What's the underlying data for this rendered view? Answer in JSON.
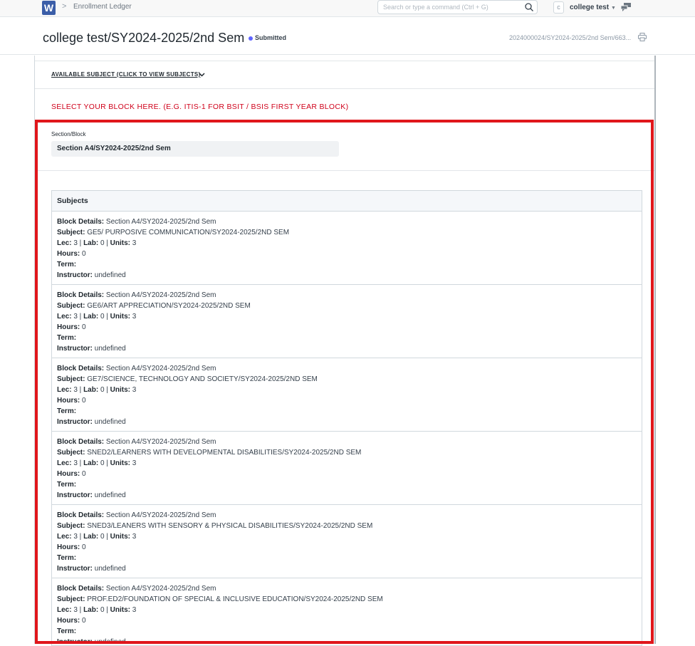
{
  "navbar": {
    "logo_letter": "W",
    "breadcrumb_sep": ">",
    "breadcrumb": "Enrollment Ledger",
    "search_placeholder": "Search or type a command (Ctrl + G)",
    "avatar_letter": "c",
    "user_name": "college test"
  },
  "header": {
    "title": "college test/SY2024-2025/2nd Sem",
    "status": "Submitted",
    "doc_id": "2024000024/SY2024-2025/2nd Sem/663..."
  },
  "form": {
    "available_subject_link": "AVAILABLE SUBJECT (CLICK TO VIEW SUBJECTS)",
    "block_instruction": "SELECT YOUR BLOCK HERE. (E.G. ITIS-1 FOR BSIT / BSIS FIRST YEAR BLOCK)",
    "section_label": "Section/Block",
    "section_value": "Section A4/SY2024-2025/2nd Sem"
  },
  "subjects": {
    "heading": "Subjects",
    "labels": {
      "block": "Block Details:",
      "subject": "Subject:",
      "lec": "Lec:",
      "lab": "Lab:",
      "units": "Units:",
      "hours": "Hours:",
      "term": "Term:",
      "instructor": "Instructor:"
    },
    "items": [
      {
        "block": "Section A4/SY2024-2025/2nd Sem",
        "subject": "GE5/ PURPOSIVE COMMUNICATION/SY2024-2025/2ND SEM",
        "lec": "3",
        "lab": "0",
        "units": "3",
        "hours": "0",
        "term": "",
        "instructor": "undefined"
      },
      {
        "block": "Section A4/SY2024-2025/2nd Sem",
        "subject": "GE6/ART APPRECIATION/SY2024-2025/2ND SEM",
        "lec": "3",
        "lab": "0",
        "units": "3",
        "hours": "0",
        "term": "",
        "instructor": "undefined"
      },
      {
        "block": "Section A4/SY2024-2025/2nd Sem",
        "subject": "GE7/SCIENCE, TECHNOLOGY AND SOCIETY/SY2024-2025/2ND SEM",
        "lec": "3",
        "lab": "0",
        "units": "3",
        "hours": "0",
        "term": "",
        "instructor": "undefined"
      },
      {
        "block": "Section A4/SY2024-2025/2nd Sem",
        "subject": "SNED2/LEARNERS WITH DEVELOPMENTAL DISABILITIES/SY2024-2025/2ND SEM",
        "lec": "3",
        "lab": "0",
        "units": "3",
        "hours": "0",
        "term": "",
        "instructor": "undefined"
      },
      {
        "block": "Section A4/SY2024-2025/2nd Sem",
        "subject": "SNED3/LEANERS WITH SENSORY & PHYSICAL DISABILITIES/SY2024-2025/2ND SEM",
        "lec": "3",
        "lab": "0",
        "units": "3",
        "hours": "0",
        "term": "",
        "instructor": "undefined"
      },
      {
        "block": "Section A4/SY2024-2025/2nd Sem",
        "subject": "PROF.ED2/FOUNDATION OF SPECIAL & INCLUSIVE EDUCATION/SY2024-2025/2ND SEM",
        "lec": "3",
        "lab": "0",
        "units": "3",
        "hours": "0",
        "term": "",
        "instructor": "undefined"
      }
    ]
  },
  "colors": {
    "highlight": "#e0161b",
    "instruction": "#d0021b",
    "status_dot": "#5e64ff"
  }
}
